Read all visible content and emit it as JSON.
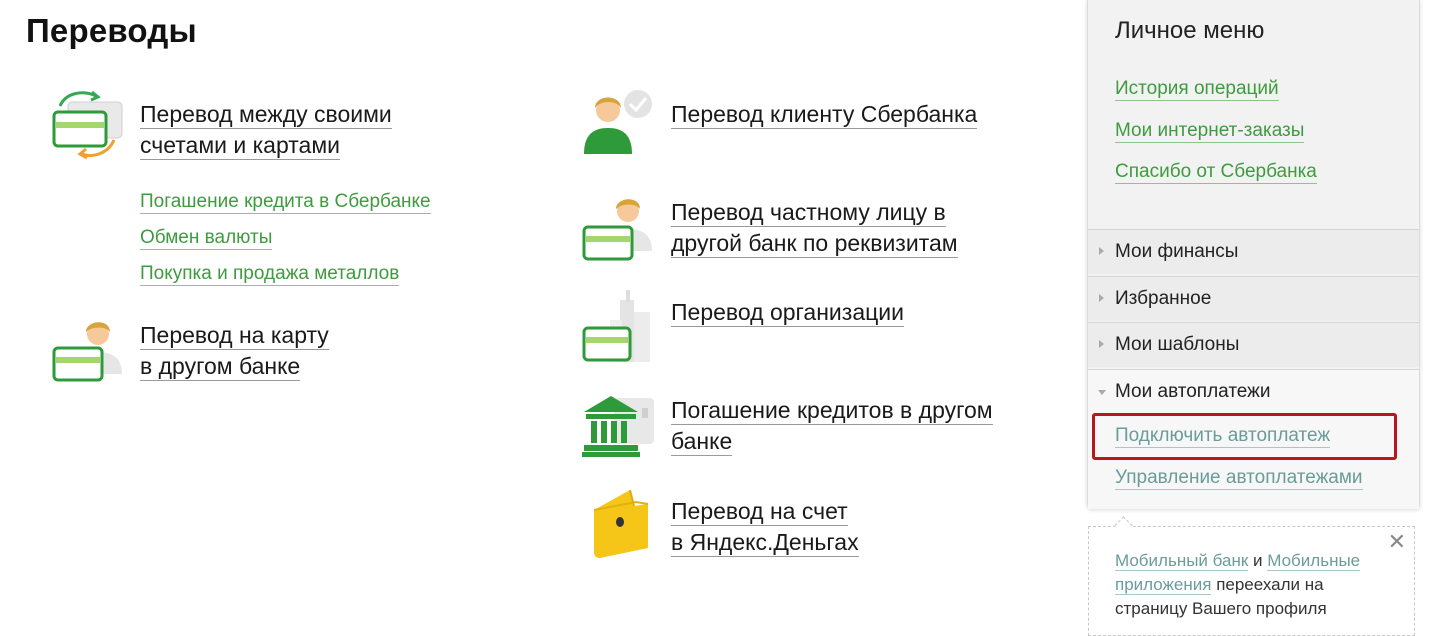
{
  "page": {
    "title": "Переводы"
  },
  "transfers_left": [
    {
      "line1": "Перевод между своими",
      "line2": "счетами и картами",
      "icon": "cards-exchange-icon"
    },
    {
      "line1": "Перевод на карту",
      "line2": "в другом банке",
      "icon": "card-person-icon"
    }
  ],
  "sublinks": [
    "Погашение кредита в Сбербанке",
    "Обмен валюты",
    "Покупка и продажа металлов"
  ],
  "transfers_right": [
    {
      "line1": "Перевод клиенту Сбербанка",
      "line2": "",
      "icon": "sber-client-icon"
    },
    {
      "line1": "Перевод частному лицу в",
      "line2": "другой банк по реквизитам",
      "icon": "person-card-icon"
    },
    {
      "line1": "Перевод организации",
      "line2": "",
      "icon": "organization-icon"
    },
    {
      "line1": "Погашение кредитов в другом",
      "line2": "банке",
      "icon": "bank-building-icon"
    },
    {
      "line1": "Перевод на счет",
      "line2": "в Яндекс.Деньгах",
      "icon": "yandex-wallet-icon"
    }
  ],
  "panel": {
    "title": "Личное меню",
    "links": [
      "История операций",
      "Мои интернет-заказы",
      "Спасибо от Сбербанка"
    ],
    "sections": [
      "Мои финансы",
      "Избранное",
      "Мои шаблоны",
      "Мои автоплатежи"
    ],
    "autopay": [
      "Подключить автоплатеж",
      "Управление автоплатежами"
    ]
  },
  "notice": {
    "link1": "Мобильный банк",
    "and": "и",
    "link2": "Мобильные приложения",
    "rest": "переехали на страницу Вашего профиля",
    "close": "✕"
  },
  "colors": {
    "green": "#3f9b3f",
    "red_highlight": "#b8171d",
    "yellow": "#f5c518"
  }
}
